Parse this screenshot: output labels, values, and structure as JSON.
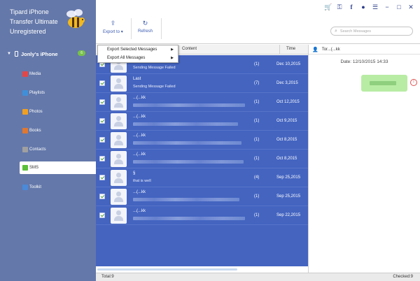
{
  "app": {
    "title_lines": [
      "Tipard iPhone",
      "Transfer Ultimate",
      "Unregistered"
    ]
  },
  "sidebar": {
    "device_name": "Jonly's iPhone",
    "device_badge": "6",
    "items": [
      {
        "label": "Media",
        "icon": "music-icon",
        "color": "#e04848"
      },
      {
        "label": "Playlists",
        "icon": "playlist-icon",
        "color": "#3f8fd8"
      },
      {
        "label": "Photos",
        "icon": "photos-icon",
        "color": "#f0a020"
      },
      {
        "label": "Books",
        "icon": "books-icon",
        "color": "#e07830"
      },
      {
        "label": "Contacts",
        "icon": "contacts-icon",
        "color": "#a0a0a0"
      },
      {
        "label": "SMS",
        "icon": "sms-icon",
        "color": "#5bbf3a",
        "active": true
      },
      {
        "label": "Toolkit",
        "icon": "toolkit-icon",
        "color": "#4a8ad8"
      }
    ]
  },
  "toolbar": {
    "export_label": "Export to",
    "refresh_label": "Refresh",
    "search_placeholder": "Search Messages"
  },
  "dropdown": {
    "items": [
      "Export Selected Messages",
      "Export All Messages"
    ]
  },
  "table": {
    "col_content": "Content",
    "col_time": "Time",
    "rows": [
      {
        "name": "",
        "message": "Sending Message Failed",
        "count": "(1)",
        "time": "Dec 10,2015"
      },
      {
        "name": "Last",
        "message": "Sending Message Failed",
        "count": "(7)",
        "time": "Dec 3,2015"
      },
      {
        "name": "...(...kk",
        "message": "",
        "count": "(1)",
        "time": "Oct 12,2015"
      },
      {
        "name": "...(...kk",
        "message": "",
        "count": "(1)",
        "time": "Oct 9,2015"
      },
      {
        "name": "...(...kk",
        "message": "",
        "count": "(1)",
        "time": "Oct 8,2015"
      },
      {
        "name": "...(...kk",
        "message": "",
        "count": "(1)",
        "time": "Oct 8,2015"
      },
      {
        "name": "§",
        "message": "that is well",
        "count": "(4)",
        "time": "Sep 25,2015"
      },
      {
        "name": "...(...kk",
        "message": "",
        "count": "(1)",
        "time": "Sep 25,2015"
      },
      {
        "name": "...(...kk",
        "message": "",
        "count": "(1)",
        "time": "Sep 22,2015"
      }
    ]
  },
  "conversation": {
    "header": "Tor...(...kk",
    "date": "Date: 12/10/2015 14:33"
  },
  "status": {
    "total": "Total:9",
    "checked": "Checked:9"
  },
  "colors": {
    "sidebar_bg": "#6478aa",
    "selection_bg": "#4464c0",
    "accent": "#3a5ab0"
  }
}
